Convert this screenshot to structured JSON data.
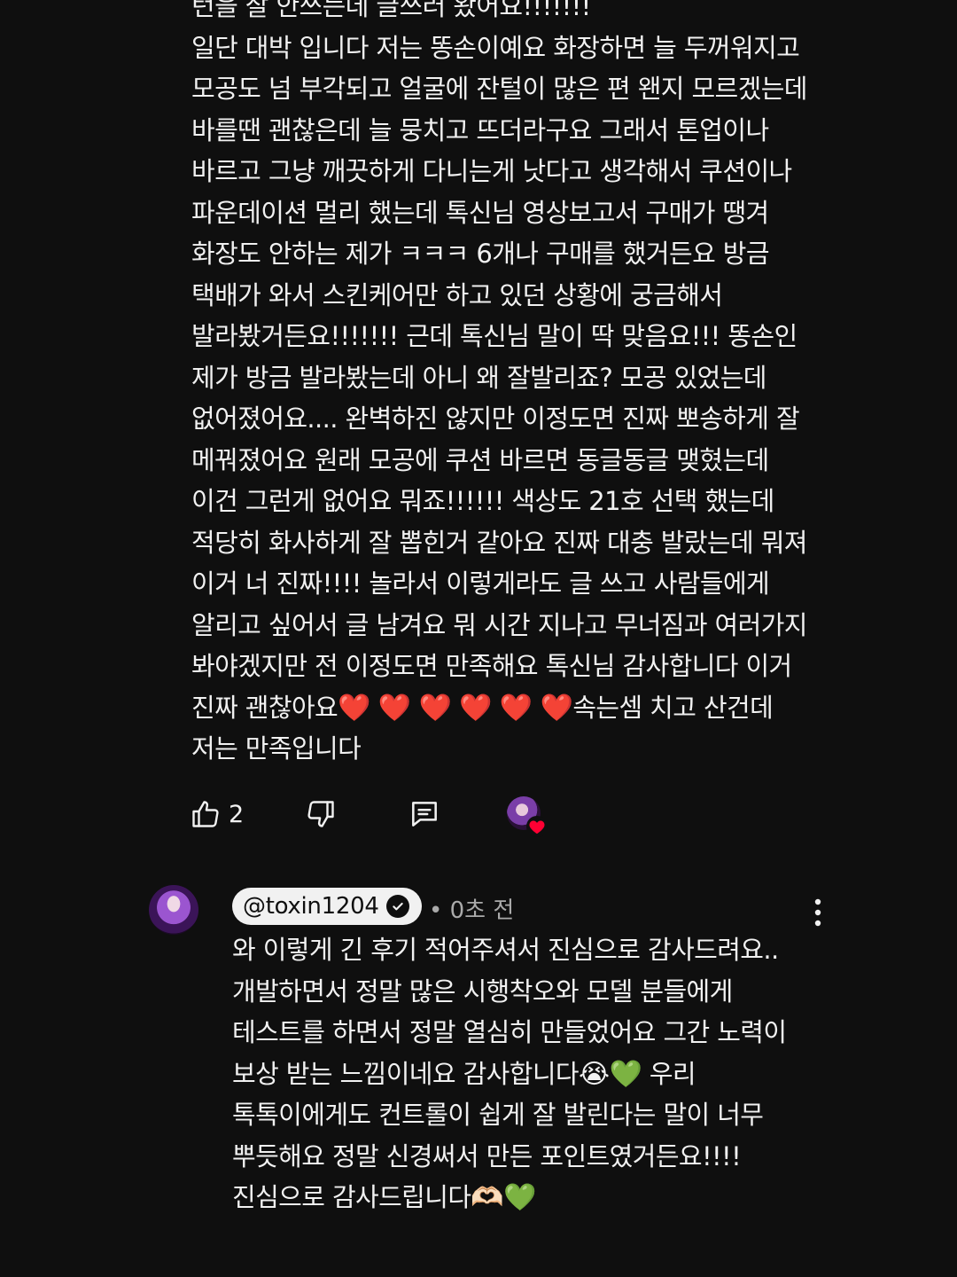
{
  "comment": {
    "text_part1": "턴을 잘 안쓰는데 글쓰러 왔어요!!!!!!!\n일단 대박 입니다 저는 똥손이예요 화장하면 늘 두꺼워지고 모공도 넘 부각되고 얼굴에 잔털이 많은 편 왠지 모르겠는데 바를땐 괜찮은데 늘 뭉치고 뜨더라구요 그래서 톤업이나 바르고 그냥 깨끗하게 다니는게 낫다고 생각해서 쿠션이나 파운데이션 멀리 했는데 톡신님 영상보고서 구매가 땡겨 화장도 안하는 제가 ㅋㅋㅋ 6개나 구매를 했거든요 방금 택배가 와서 스킨케어만 하고 있던 상황에 궁금해서 발라봤거든요!!!!!!! 근데 톡신님 말이 딱 맞음요!!! 똥손인 제가 방금 발라봤는데 아니 왜 잘발리죠? 모공 있었는데 없어졌어요.... 완벽하진 않지만 이정도면 진짜 뽀송하게 잘 메꿔졌어요 원래 모공에 쿠션 바르면 동글동글 맺혔는데 이건 그런게 없어요 뭐죠!!!!!! 색상도 21호 선택 했는데 적당히 화사하게 잘 뽑힌거 같아요 진짜 대충 발랐는데 뭐져 이거 너 진짜!!!! 놀라서 이렇게라도 글 쓰고 사람들에게 알리고 싶어서 글 남겨요 뭐 시간 지나고 무너짐과 여러가지 봐야겠지만 전 이정도면 만족해요 톡신님 감사합니다 이거 진짜 괜찮아요",
    "emoji_hearts": "❤️ ❤️ ❤️ ❤️ ❤️ ❤️",
    "text_part2": "속는셈 치고 산건데 저는 만족입니다",
    "like_count": "2",
    "icons": {
      "like": "thumbs-up-icon",
      "dislike": "thumbs-down-icon",
      "reply": "comment-icon",
      "creator_heart": "creator-heart-icon"
    }
  },
  "reply": {
    "author": "@toxin1204",
    "separator": "•",
    "time": "0초 전",
    "text_part1": "와 이렇게 긴 후기 적어주셔서 진심으로 감사드려요.. 개발하면서 정말 많은 시행착오와 모델 분들에게 테스트를 하면서 정말 열심히 만들었어요 그간 노력이 보상 받는 느낌이네요 감사합니다",
    "emoji_a": "😭💚",
    "text_part2": " 우리 톡톡이에게도 컨트롤이 쉽게 잘 발린다는 말이 너무 뿌듯해요 정말 신경써서 만든 포인트였거든요!!!! 진심으로 감사드립니다",
    "emoji_b": "🫶🏻💚"
  },
  "colors": {
    "background": "#0f0f0f",
    "text": "#f1f1f1",
    "secondary_text": "#aaaaaa",
    "heart": "#ff0033"
  }
}
